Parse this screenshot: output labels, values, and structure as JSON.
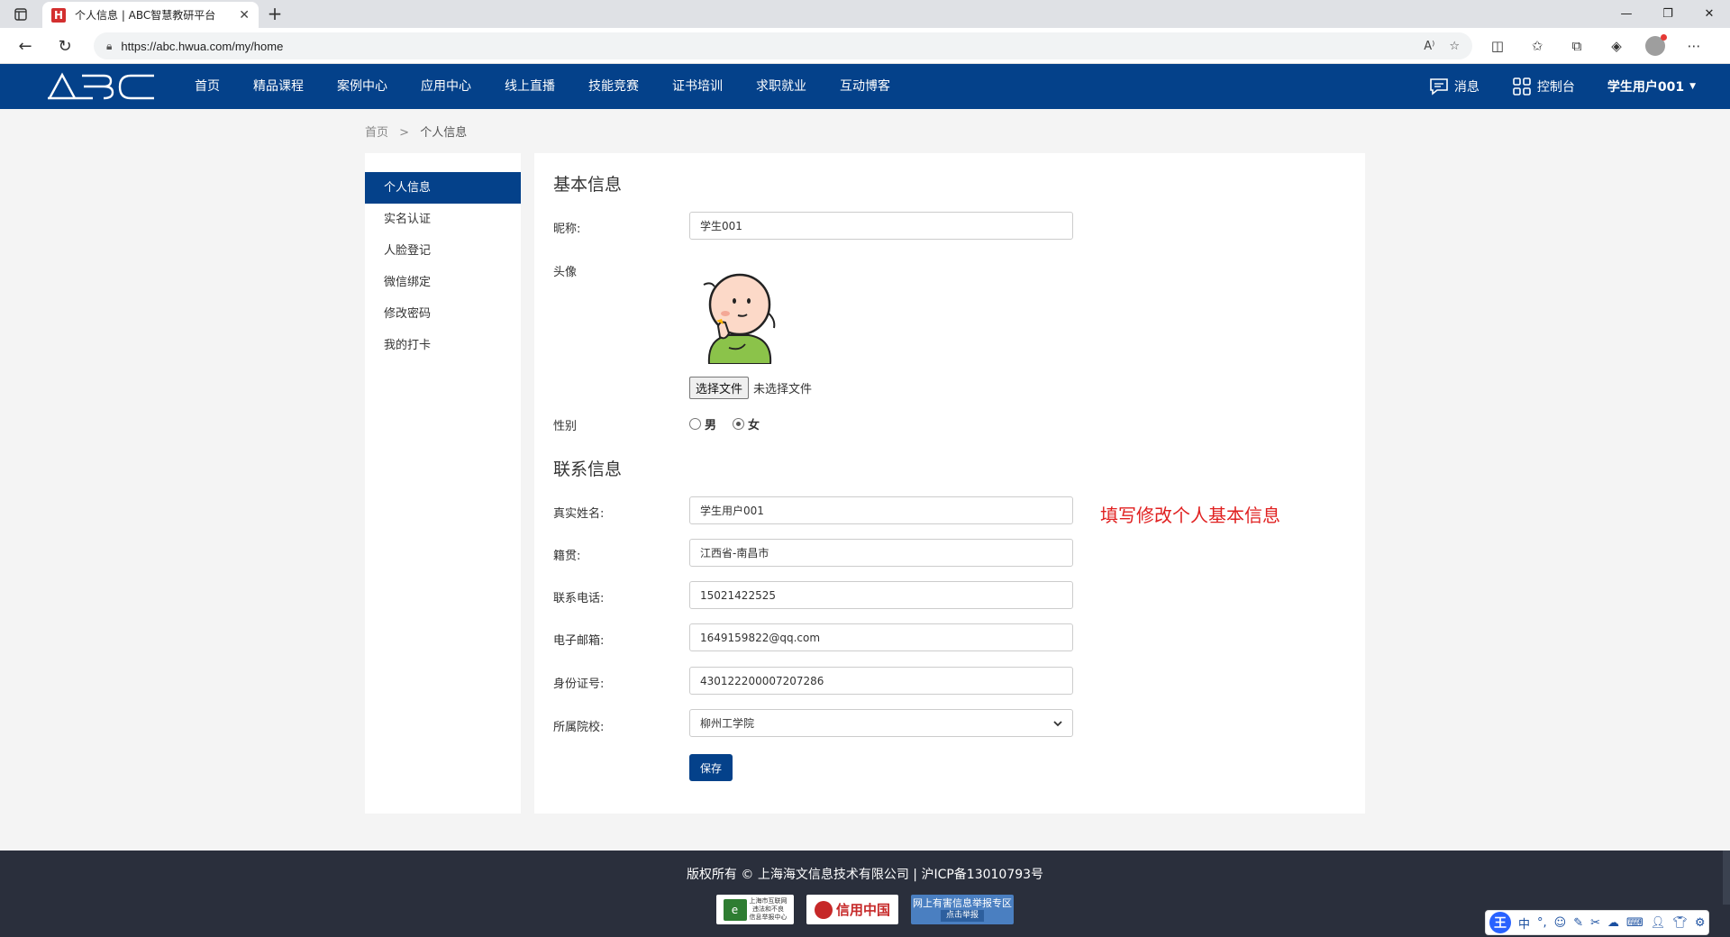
{
  "browser": {
    "tab_title": "个人信息 | ABC智慧教研平台",
    "favicon_letter": "H",
    "url": "https://abc.hwua.com/my/home"
  },
  "header": {
    "logo_text": "ABC",
    "nav": [
      "首页",
      "精品课程",
      "案例中心",
      "应用中心",
      "线上直播",
      "技能竞赛",
      "证书培训",
      "求职就业",
      "互动博客"
    ],
    "messages_label": "消息",
    "console_label": "控制台",
    "user_label": "学生用户001"
  },
  "breadcrumb": {
    "home": "首页",
    "separator": ">",
    "current": "个人信息"
  },
  "sidebar": {
    "items": [
      "个人信息",
      "实名认证",
      "人脸登记",
      "微信绑定",
      "修改密码",
      "我的打卡"
    ],
    "active_index": 0
  },
  "basic": {
    "title": "基本信息",
    "nickname_label": "昵称:",
    "nickname_value": "学生001",
    "avatar_label": "头像",
    "file_button": "选择文件",
    "file_status": "未选择文件",
    "gender_label": "性别",
    "gender_male": "男",
    "gender_female": "女",
    "gender_selected": "女"
  },
  "contact": {
    "title": "联系信息",
    "fields": [
      {
        "label": "真实姓名:",
        "value": "学生用户001"
      },
      {
        "label": "籍贯:",
        "value": "江西省-南昌市"
      },
      {
        "label": "联系电话:",
        "value": "15021422525"
      },
      {
        "label": "电子邮箱:",
        "value": "1649159822@qq.com"
      },
      {
        "label": "身份证号:",
        "value": "430122200007207286"
      }
    ],
    "school_label": "所属院校:",
    "school_value": "柳州工学院"
  },
  "save_label": "保存",
  "annotation": "填写修改个人基本信息",
  "footer": {
    "copyright": "版权所有 © 上海海文信息技术有限公司 | 沪ICP备13010793号",
    "badge1_line1": "上海市互联网",
    "badge1_line2": "违法和不良",
    "badge1_line3": "信息举报中心",
    "badge2": "信用中国",
    "badge3_line1": "网上有害信息举报专区",
    "badge3_line2": "点击举报"
  },
  "ime": {
    "logo": "王",
    "mode": "中"
  },
  "colors": {
    "primary": "#04418a",
    "footer_bg": "#2a2f3c",
    "annotation": "#e02020",
    "page_bg": "#f4f4f4"
  }
}
